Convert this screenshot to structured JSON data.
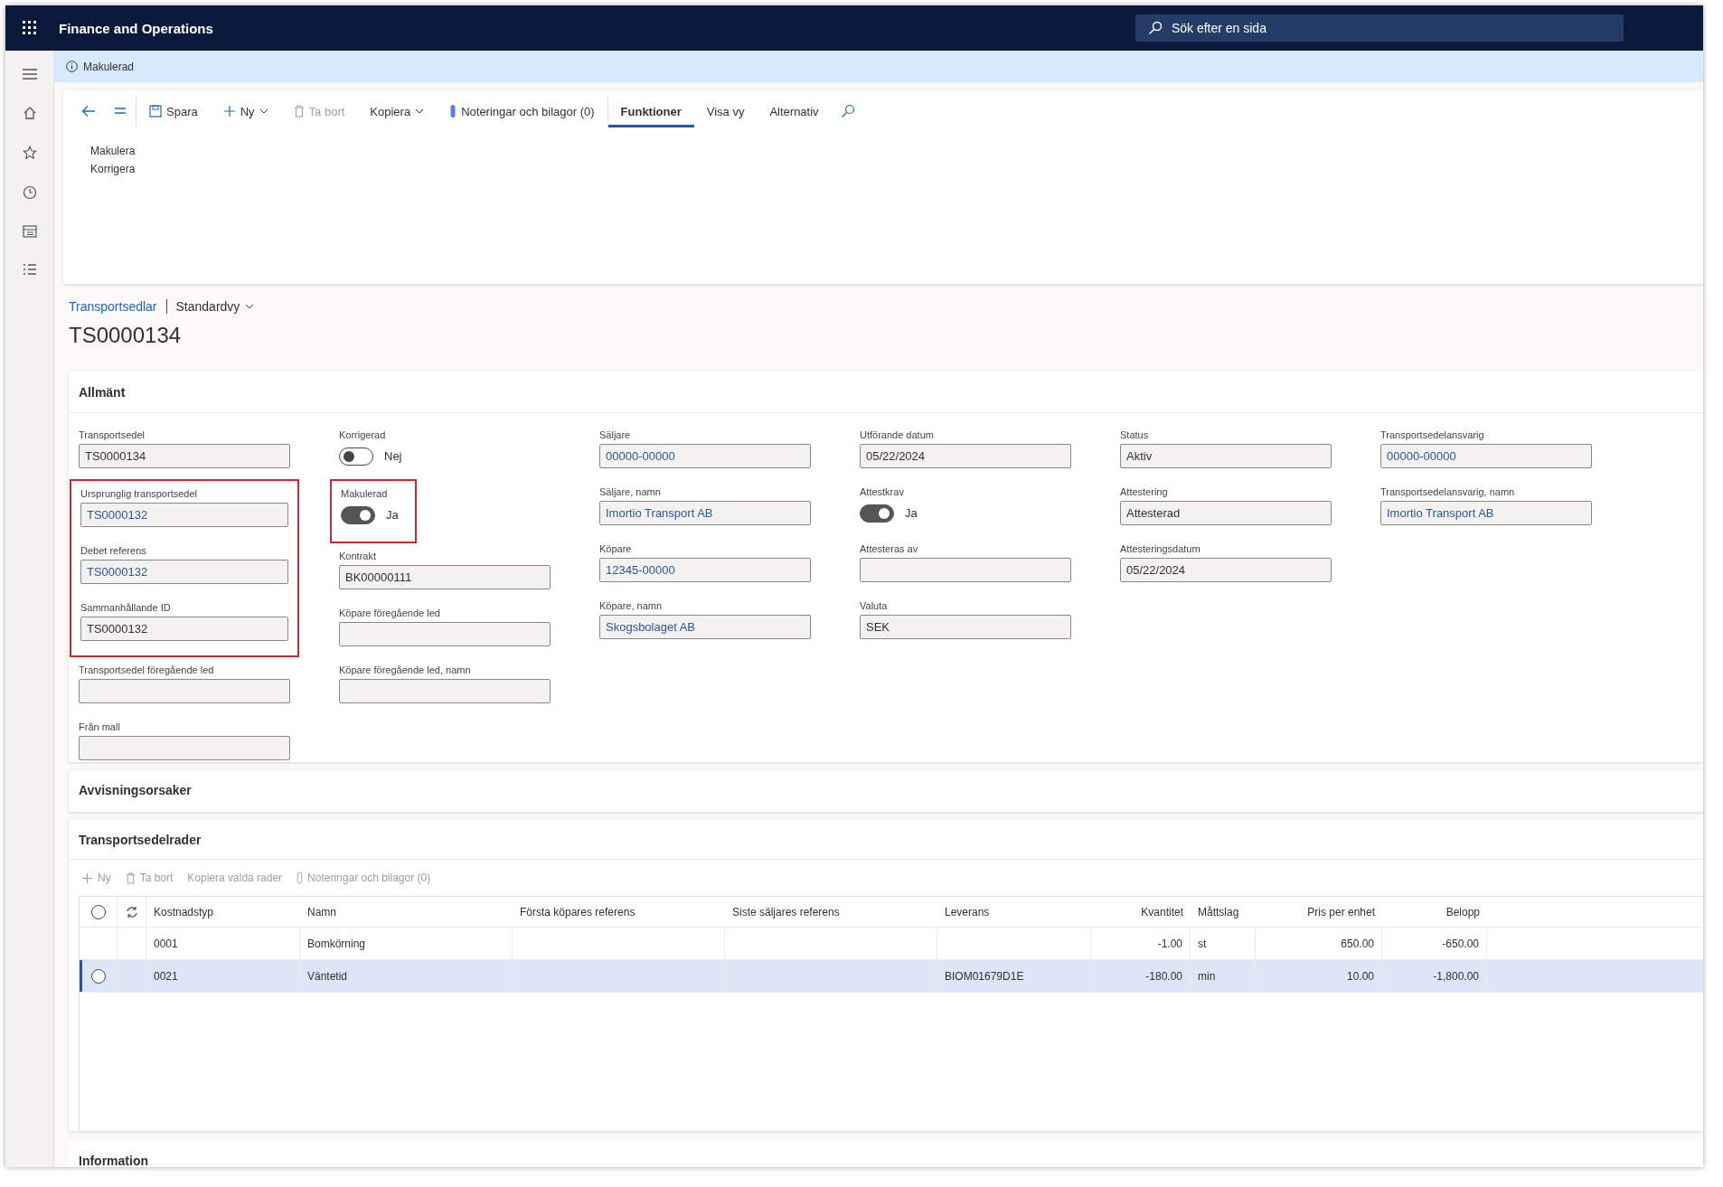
{
  "header": {
    "title": "Finance and Operations",
    "search_placeholder": "Sök efter en sida"
  },
  "message": {
    "text": "Makulerad"
  },
  "toolbar": [
    {
      "kind": "back"
    },
    {
      "kind": "lines"
    },
    {
      "kind": "save",
      "label": "Spara"
    },
    {
      "kind": "new",
      "label": "Ny"
    },
    {
      "kind": "delete",
      "label": "Ta bort",
      "disabled": true
    },
    {
      "kind": "copy",
      "label": "Kopiera"
    },
    {
      "kind": "notes",
      "label": "Noteringar och bilagor (0)"
    },
    {
      "kind": "tab",
      "label": "Funktioner",
      "selected": true
    },
    {
      "kind": "tab",
      "label": "Visa vy",
      "selected": false
    },
    {
      "kind": "tab",
      "label": "Alternativ",
      "selected": false
    },
    {
      "kind": "search"
    }
  ],
  "action_menu": [
    "Makulera",
    "Korrigera"
  ],
  "breadcrumb": {
    "link": "Transportsedlar",
    "view": "Standardvy"
  },
  "title": "TS0000134",
  "general": {
    "heading": "Allmänt",
    "columns": [
      [
        {
          "kind": "field",
          "label": "Transportsedel",
          "value": "TS0000134",
          "link": false
        },
        {
          "kind": "group",
          "highlighted": true,
          "items": [
            {
              "kind": "field",
              "label": "Ursprunglig transportsedel",
              "value": "TS0000132",
              "link": true
            },
            {
              "kind": "field",
              "label": "Debet referens",
              "value": "TS0000132",
              "link": true
            },
            {
              "kind": "field",
              "label": "Sammanhållande ID",
              "value": "TS0000132",
              "link": false
            }
          ]
        },
        {
          "kind": "field",
          "label": "Transportsedel föregående led"
        },
        {
          "kind": "field",
          "label": "Från mall"
        }
      ],
      [
        {
          "kind": "toggle",
          "label": "Korrigerad",
          "on": false,
          "text": "Nej"
        },
        {
          "kind": "group",
          "highlighted": true,
          "items": [
            {
              "kind": "toggle",
              "label": "Makulerad",
              "on": true,
              "text": "Ja"
            }
          ]
        },
        {
          "kind": "field",
          "label": "Kontrakt",
          "value": "BK00000111",
          "link": false
        },
        {
          "kind": "field",
          "label": "Köpare föregående led"
        },
        {
          "kind": "field",
          "label": "Köpare föregående led, namn"
        }
      ],
      [
        {
          "kind": "field",
          "label": "Säljare",
          "value": "00000-00000",
          "link": true
        },
        {
          "kind": "field",
          "label": "Säljare, namn",
          "value": "Imortio Transport AB",
          "link": true
        },
        {
          "kind": "field",
          "label": "Köpare",
          "value": "12345-00000",
          "link": true
        },
        {
          "kind": "field",
          "label": "Köpare, namn",
          "value": "Skogsbolaget AB",
          "link": true
        }
      ],
      [
        {
          "kind": "field",
          "label": "Utförande datum",
          "value": "05/22/2024",
          "link": false
        },
        {
          "kind": "toggle",
          "label": "Attestkrav",
          "on": true,
          "text": "Ja"
        },
        {
          "kind": "field",
          "label": "Attesteras av"
        },
        {
          "kind": "field",
          "label": "Valuta",
          "value": "SEK",
          "link": false
        }
      ],
      [
        {
          "kind": "field",
          "label": "Status",
          "value": "Aktiv",
          "link": false
        },
        {
          "kind": "field",
          "label": "Attestering",
          "value": "Attesterad",
          "link": false
        },
        {
          "kind": "field",
          "label": "Attesteringsdatum",
          "value": "05/22/2024",
          "link": false
        }
      ],
      [
        {
          "kind": "field",
          "label": "Transportsedelansvarig",
          "value": "00000-00000",
          "link": true
        },
        {
          "kind": "field",
          "label": "Transportsedelansvarig, namn",
          "value": "Imortio Transport AB",
          "link": true
        }
      ]
    ]
  },
  "rejection": {
    "heading": "Avvisningsorsaker"
  },
  "lines": {
    "heading": "Transportsedelrader",
    "toolbar": [
      {
        "kind": "new",
        "label": "Ny",
        "disabled": true
      },
      {
        "kind": "delete",
        "label": "Ta bort",
        "disabled": true
      },
      {
        "kind": "copy",
        "label": "Kopiera valda rader",
        "disabled": true
      },
      {
        "kind": "notes",
        "label": "Noteringar och bilagor (0)",
        "disabled": true
      }
    ],
    "all_selected": false,
    "columns": [
      {
        "label": "Kostnadstyp",
        "kind": "text"
      },
      {
        "label": "Namn",
        "kind": "text"
      },
      {
        "label": "Första köpares referens",
        "kind": "text"
      },
      {
        "label": "Siste säljares referens",
        "kind": "text"
      },
      {
        "label": "Leverans",
        "kind": "text"
      },
      {
        "label": "Kvantitet",
        "kind": "number"
      },
      {
        "label": "Måttslag",
        "kind": "text"
      },
      {
        "label": "Pris per enhet",
        "kind": "number"
      },
      {
        "label": "Belopp",
        "kind": "number"
      }
    ],
    "rows": [
      {
        "selected": false,
        "cells": [
          "0001",
          "Bomkörning",
          "",
          "",
          "",
          "-1.00",
          "st",
          "650.00",
          "-650.00"
        ]
      },
      {
        "selected": true,
        "cells": [
          "0021",
          "Väntetid",
          "",
          "",
          "BIOM01679D1E",
          "-180.00",
          "min",
          "10.00",
          "-1,800.00"
        ]
      }
    ]
  },
  "information": {
    "heading": "Information"
  }
}
